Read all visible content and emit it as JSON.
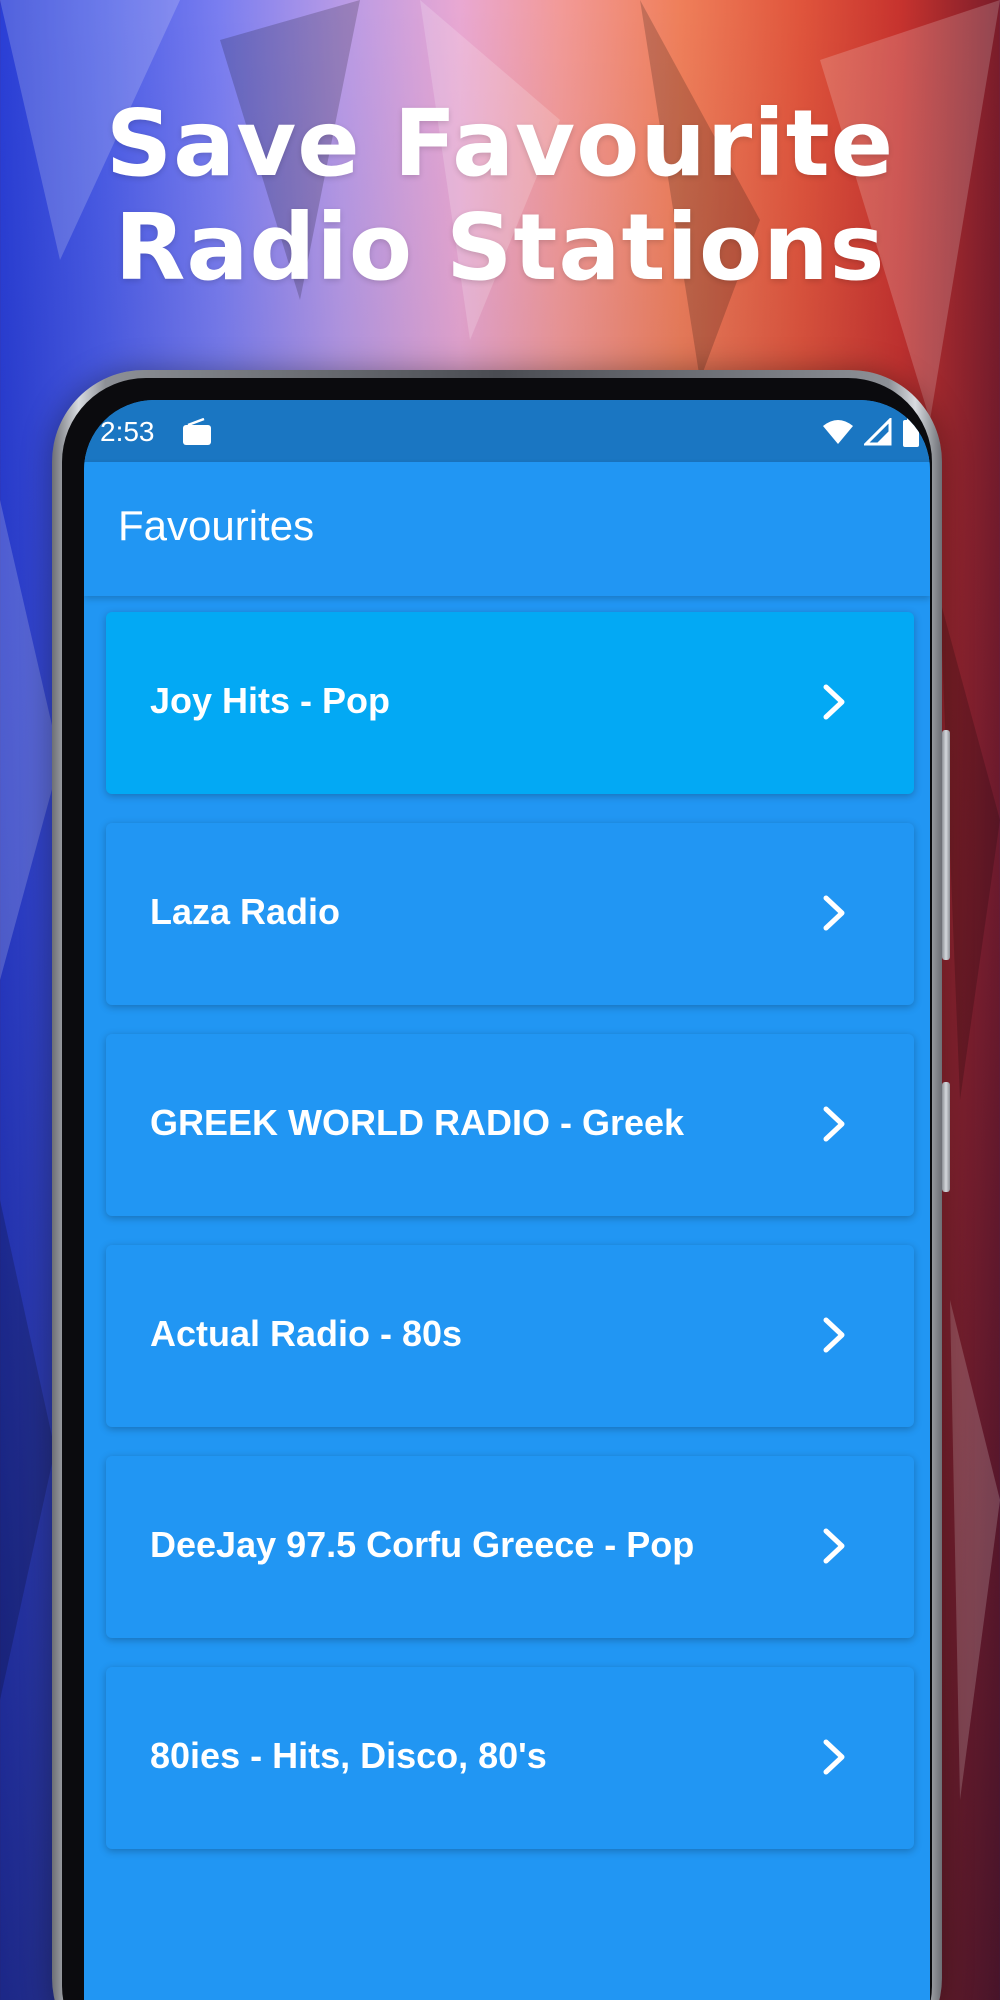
{
  "promo": {
    "headline_line1": "Save Favourite",
    "headline_line2": "Radio Stations"
  },
  "status_bar": {
    "time": "2:53",
    "icons": [
      "radio-icon",
      "wifi-icon",
      "cellular-signal-icon",
      "battery-icon"
    ]
  },
  "app_bar": {
    "title": "Favourites"
  },
  "favourites": [
    {
      "label": "Joy Hits - Pop",
      "selected": true
    },
    {
      "label": "Laza Radio"
    },
    {
      "label": "GREEK WORLD RADIO - Greek"
    },
    {
      "label": "Actual Radio - 80s"
    },
    {
      "label": "DeeJay 97.5 Corfu Greece - Pop"
    },
    {
      "label": "80ies - Hits, Disco, 80's"
    }
  ],
  "colors": {
    "primary": "#2196f3",
    "status_bar": "#1a76c2",
    "selected_item": "#03a9f4",
    "text": "#ffffff"
  }
}
